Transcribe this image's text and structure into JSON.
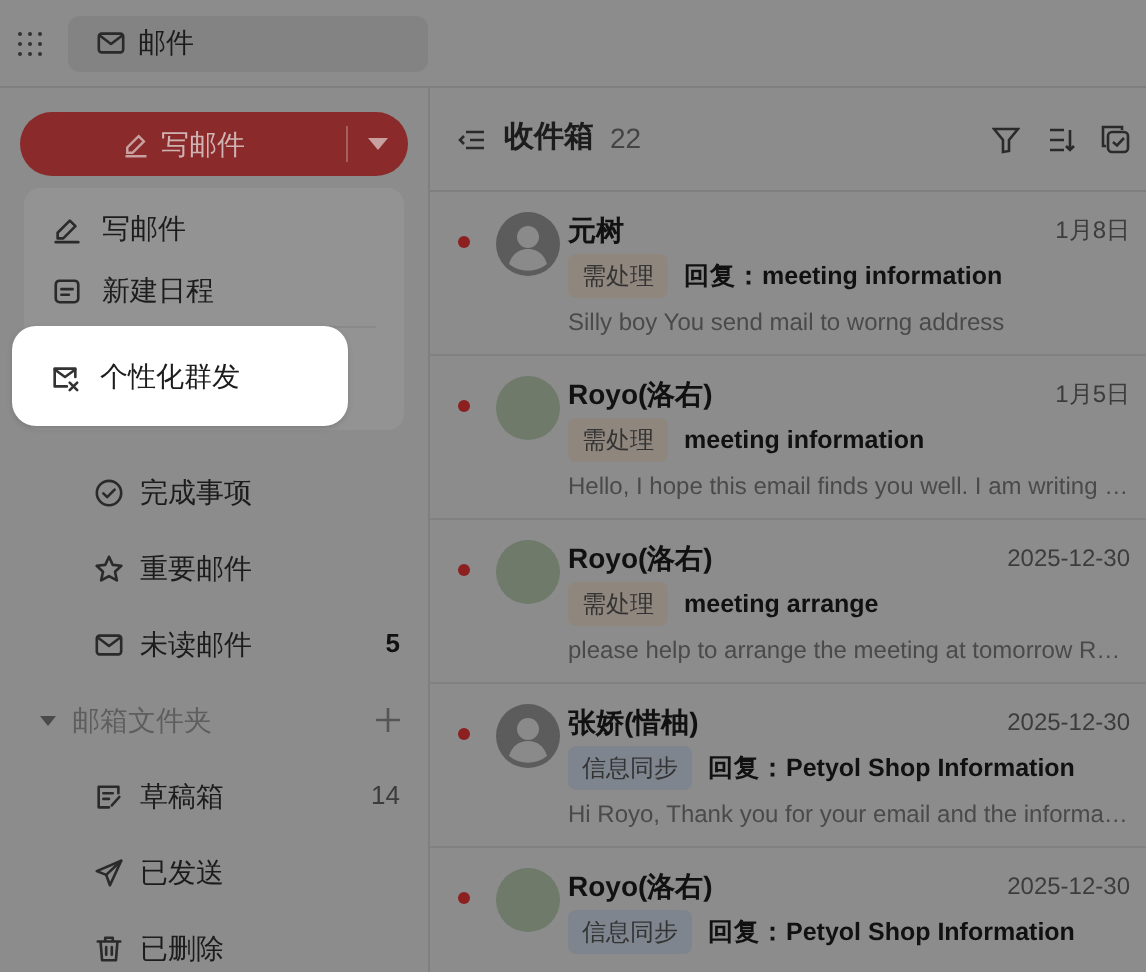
{
  "top_bar": {
    "tab": {
      "label": "邮件"
    }
  },
  "sidebar": {
    "compose_button": {
      "label": "写邮件"
    },
    "compose_menu": [
      {
        "kind": "compose",
        "label": "写邮件",
        "highlighted": false
      },
      {
        "kind": "calendar",
        "label": "新建日程",
        "highlighted": false
      },
      {
        "kind": "mass",
        "label": "个性化群发",
        "highlighted": true
      }
    ],
    "items": [
      {
        "kind": "done",
        "label": "完成事项"
      },
      {
        "kind": "star",
        "label": "重要邮件"
      },
      {
        "kind": "mail",
        "label": "未读邮件",
        "count": "5",
        "count_bold": true
      }
    ],
    "folder_section": {
      "label": "邮箱文件夹",
      "expanded": true
    },
    "folders": [
      {
        "kind": "draft",
        "label": "草稿箱",
        "count": "14",
        "count_bold": false
      },
      {
        "kind": "sent",
        "label": "已发送"
      },
      {
        "kind": "trash",
        "label": "已删除"
      }
    ]
  },
  "mail_list": {
    "title": "收件箱",
    "count": "22",
    "messages": [
      {
        "unread": true,
        "kind": "default",
        "sender": "元树",
        "date": "1月8日",
        "tag": "需处理",
        "color": "#8f867e",
        "subject": "回复：meeting information",
        "preview": "Silly boy You send mail to worng address"
      },
      {
        "unread": true,
        "kind": "photo",
        "sender": "Royo(洛右)",
        "date": "1月5日",
        "tag": "需处理",
        "color": "#8f867e",
        "subject": "meeting information",
        "preview": "Hello, I hope this email finds you well. I am writing …"
      },
      {
        "unread": true,
        "kind": "photo",
        "sender": "Royo(洛右)",
        "date": "2025-12-30",
        "tag": "需处理",
        "color": "#8f867e",
        "subject": "meeting arrange",
        "preview": "please help to arrange the meeting at tomorrow R…"
      },
      {
        "unread": true,
        "kind": "default",
        "sender": "张娇(惜柚)",
        "date": "2025-12-30",
        "tag": "信息同步",
        "color": "#7f858e",
        "subject": "回复：Petyol Shop Information",
        "preview": "Hi Royo, Thank you for your email and the informa…"
      },
      {
        "unread": true,
        "kind": "photo",
        "sender": "Royo(洛右)",
        "date": "2025-12-30",
        "tag": "信息同步",
        "color": "#7f858e",
        "subject": "回复：Petyol Shop Information"
      }
    ]
  }
}
